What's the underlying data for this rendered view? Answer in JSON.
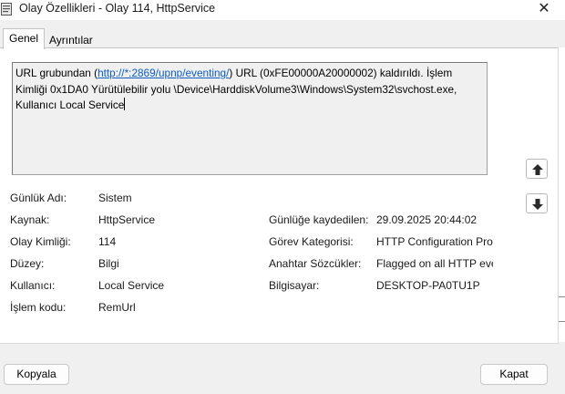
{
  "window": {
    "title": "Olay Özellikleri - Olay 114, HttpService",
    "close_glyph": "✕"
  },
  "tabs": [
    {
      "label": "Genel",
      "selected": true
    },
    {
      "label": "Ayrıntılar",
      "selected": false
    }
  ],
  "description": {
    "prefix": "URL grubundan (",
    "link": "http://*:2869/upnp/eventing/",
    "suffix": ") URL (0xFE00000A20000002) kaldırıldı. İşlem Kimliği 0x1DA0 Yürütülebilir yolu \\Device\\HarddiskVolume3\\Windows\\System32\\svchost.exe, Kullanıcı Local Service"
  },
  "fields_left": [
    {
      "label": "Günlük Adı:",
      "value": "Sistem"
    },
    {
      "label": "Kaynak:",
      "value": "HttpService"
    },
    {
      "label": "Olay Kimliği:",
      "value": "114"
    },
    {
      "label": "Düzey:",
      "value": "Bilgi"
    },
    {
      "label": "Kullanıcı:",
      "value": "Local Service"
    },
    {
      "label": "İşlem kodu:",
      "value": "RemUrl"
    }
  ],
  "fields_right": [
    {
      "label": "Günlüğe kaydedilen:",
      "value": "29.09.2025 20:44:02"
    },
    {
      "label": "Görev Kategorisi:",
      "value": "HTTP Configuration Pro"
    },
    {
      "label": "Anahtar Sözcükler:",
      "value": "Flagged on all HTTP eve"
    },
    {
      "label": "Bilgisayar:",
      "value": "DESKTOP-PA0TU1P"
    }
  ],
  "buttons": {
    "copy": "Kopyala",
    "close": "Kapat"
  },
  "icons": {
    "app": "event-viewer-icon",
    "up": "arrow-up-icon",
    "down": "arrow-down-icon"
  }
}
